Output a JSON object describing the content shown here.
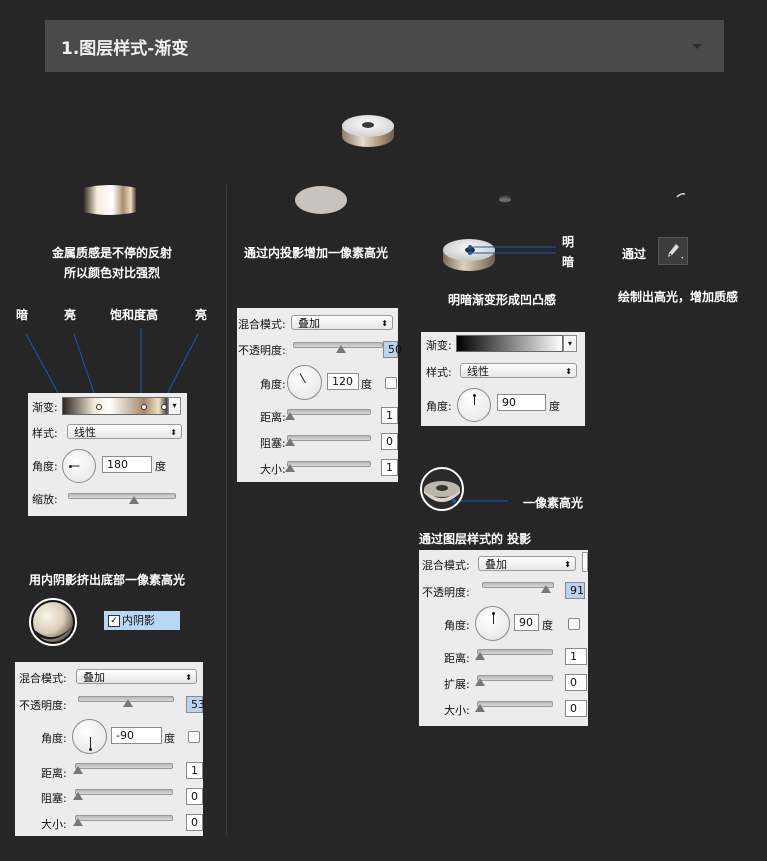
{
  "header": {
    "title": "1.图层样式-渐变"
  },
  "captions": {
    "metal_line1": "金属质感是不停的反射",
    "metal_line2": "所以颜色对比强烈",
    "inner_shadow_top": "通过内投影增加一像素高光",
    "dark_light": "明暗渐变形成凹凸感",
    "bright": "明",
    "dark": "暗",
    "pass": "通过",
    "draw_highlight": "绘制出高光，增加质感",
    "an": "暗",
    "liang1": "亮",
    "saturation": "饱和度高",
    "liang2": "亮",
    "inner_shadow_bottom": "用内阴影挤出底部一像素高光",
    "one_px": "一像素高光",
    "drop_shadow": "通过图层样式的  投影"
  },
  "gradient_panel": {
    "gradient_label": "渐变:",
    "style_label": "样式:",
    "style_value": "线性",
    "angle_label": "角度:",
    "angle_value": "180",
    "degree": "度",
    "scale_label": "缩放:"
  },
  "inner_glow_panel": {
    "blend_label": "混合模式:",
    "blend_value": "叠加",
    "opacity_label": "不透明度:",
    "opacity_value": "50",
    "angle_label": "角度:",
    "angle_value": "120",
    "degree": "度",
    "distance_label": "距离:",
    "distance_value": "1",
    "choke_label": "阻塞:",
    "choke_value": "0",
    "size_label": "大小:",
    "size_value": "1"
  },
  "gradient_panel2": {
    "gradient_label": "渐变:",
    "style_label": "样式:",
    "style_value": "线性",
    "angle_label": "角度:",
    "angle_value": "90",
    "degree": "度"
  },
  "inner_shadow_checkbox": {
    "label": "内阴影"
  },
  "inner_shadow_panel": {
    "blend_label": "混合模式:",
    "blend_value": "叠加",
    "opacity_label": "不透明度:",
    "opacity_value": "53",
    "angle_label": "角度:",
    "angle_value": "-90",
    "degree": "度",
    "distance_label": "距离:",
    "distance_value": "1",
    "choke_label": "阻塞:",
    "choke_value": "0",
    "size_label": "大小:",
    "size_value": "0"
  },
  "drop_shadow_panel": {
    "blend_label": "混合模式:",
    "blend_value": "叠加",
    "opacity_label": "不透明度:",
    "opacity_value": "91",
    "angle_label": "角度:",
    "angle_value": "90",
    "degree": "度",
    "distance_label": "距离:",
    "distance_value": "1",
    "spread_label": "扩展:",
    "spread_value": "0",
    "size_label": "大小:",
    "size_value": "0"
  },
  "icons": [
    "chevron-down-icon",
    "pen-tool-icon",
    "checkbox-checked-icon"
  ],
  "colors": {
    "background": "#262626",
    "header": "#4a4a4a",
    "annotation_line": "#1c56b8",
    "panel": "#ececec"
  }
}
